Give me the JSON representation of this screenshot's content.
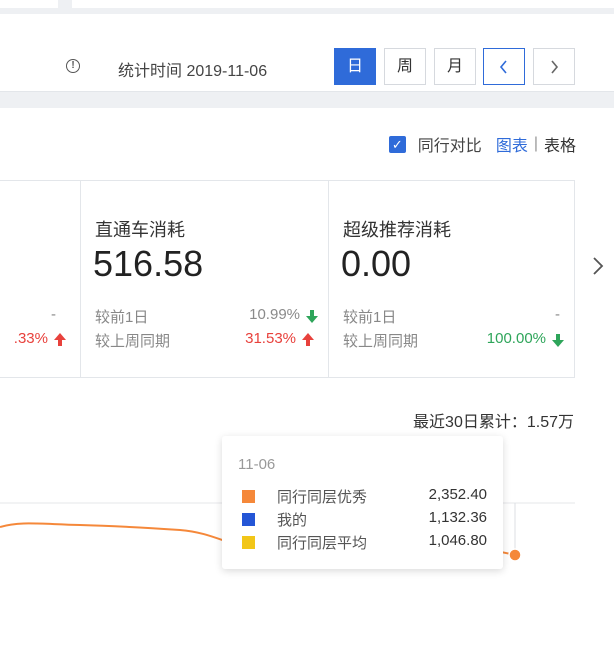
{
  "header": {
    "stat_time": "统计时间 2019-11-06",
    "period_buttons": [
      "日",
      "周",
      "月"
    ],
    "active_period": "日",
    "prev_icon": "chevron-left-icon",
    "next_icon": "chevron-right-icon",
    "info_icon": "info-circle-icon"
  },
  "toolbar": {
    "compare_label": "同行对比",
    "compare_checked": true,
    "view_chart": "图表",
    "view_separator": "|",
    "view_table": "表格"
  },
  "metrics": [
    {
      "title": "",
      "value": "",
      "prev_day_label": "",
      "prev_day_value": "-",
      "last_week_label": "",
      "last_week_value": ".33%",
      "last_week_trend": "up"
    },
    {
      "title": "直通车消耗",
      "value": "516.58",
      "prev_day_label": "较前1日",
      "prev_day_value": "10.99%",
      "prev_day_trend": "down",
      "last_week_label": "较上周同期",
      "last_week_value": "31.53%",
      "last_week_trend": "up"
    },
    {
      "title": "超级推荐消耗",
      "value": "0.00",
      "prev_day_label": "较前1日",
      "prev_day_value": "-",
      "last_week_label": "较上周同期",
      "last_week_value": "100.00%",
      "last_week_trend": "down"
    }
  ],
  "colors": {
    "accent": "#2f6bd9",
    "up": "#e8413c",
    "down": "#2ea55a",
    "series_top": "#f5883a",
    "series_mine": "#2456d6",
    "series_avg": "#f2c618"
  },
  "total_30d": "最近30日累计：1.57万",
  "tooltip": {
    "date": "11-06",
    "rows": [
      {
        "name": "同行同层优秀",
        "value": "2,352.40"
      },
      {
        "name": "我的",
        "value": "1,132.36"
      },
      {
        "name": "同行同层平均",
        "value": "1,046.80"
      }
    ]
  }
}
